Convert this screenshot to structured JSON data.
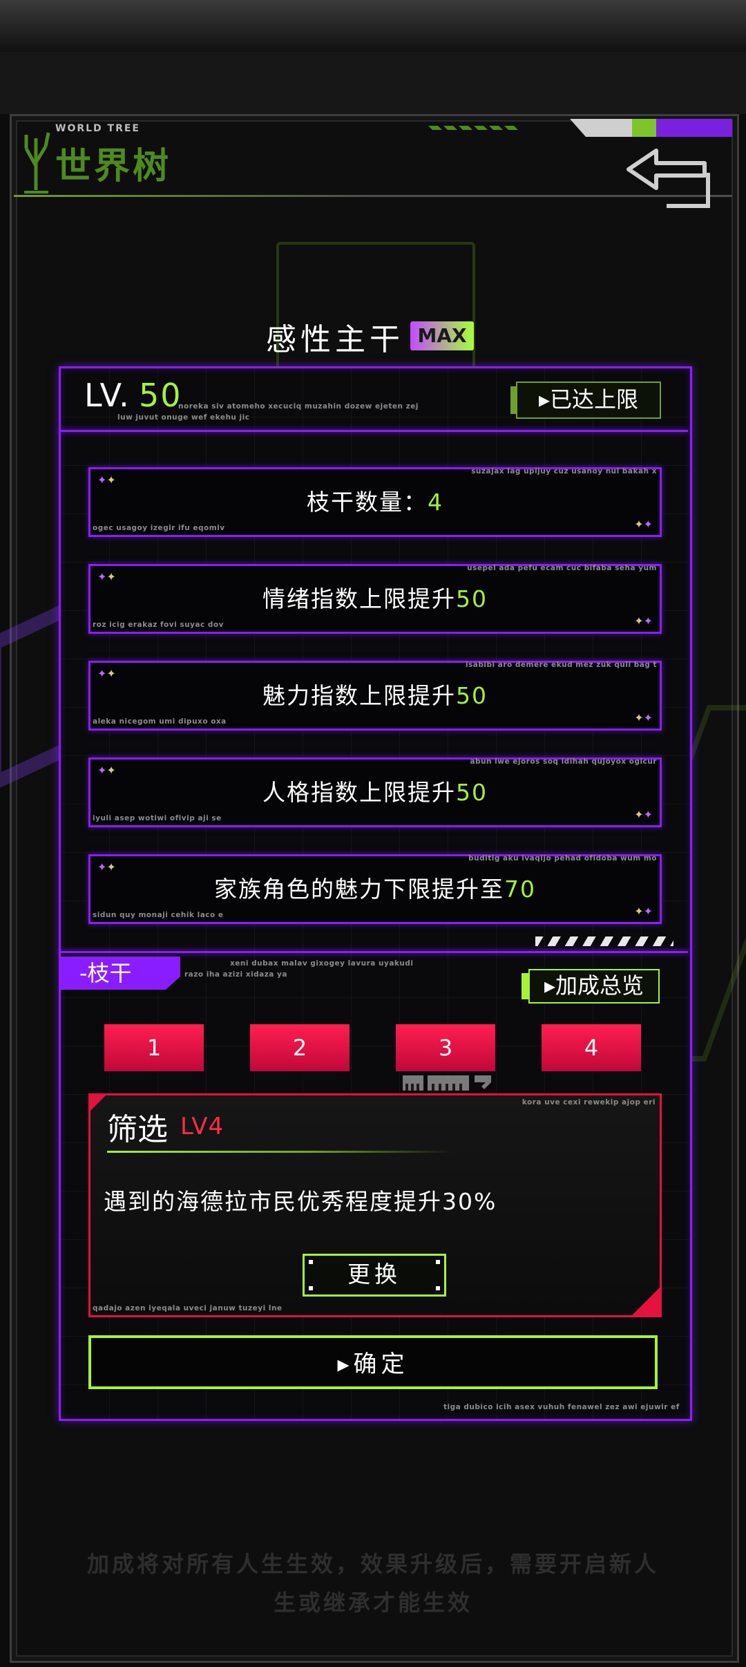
{
  "header": {
    "small_title": "WORLD TREE",
    "title": "世界树",
    "back_icon": "back-arrow-icon"
  },
  "branch": {
    "title": "感性主干",
    "max_badge": "MAX",
    "level_prefix": "LV.",
    "level_value": "50",
    "level_status": "已达上限",
    "level_caption_1": "noreka siv atomeho xecuciq muzahin dozew ejeten zej",
    "level_caption_2": "luw juvut onuge wef ekehu jic"
  },
  "effects": [
    {
      "text": "枝干数量：",
      "value": "4",
      "caption_tr": "suzajax lag upijuy cuz usanoy nul bakah x",
      "caption_bl": "ogec usagoy izegir ifu eqomiv"
    },
    {
      "text": "情绪指数上限提升",
      "value": "50",
      "caption_tr": "usepel ada pefu ecam cuc bifaba seha yum",
      "caption_bl": "roz icig erakaz fovi suyac dov"
    },
    {
      "text": "魅力指数上限提升",
      "value": "50",
      "caption_tr": "isabibi aro demere ekud mez zuk quli bag t",
      "caption_bl": "aleka nicegom umi dipuxo oxa"
    },
    {
      "text": "人格指数上限提升",
      "value": "50",
      "caption_tr": "abun iwe ejoros soq idihah qujoyox ogicur",
      "caption_bl": "iyuli asep wotiwi ofivip aji se"
    },
    {
      "text": "家族角色的魅力下限提升至",
      "value": "70",
      "caption_tr": "buditig aku ivaqijo pehad ofidoba wum mo",
      "caption_bl": "sidun quy monaji cehik laco e"
    }
  ],
  "sub_branch": {
    "tag": "-枝干",
    "caption_1": "xeni dubax malav gixogey lavura uyakudi",
    "caption_2": "razo iha azizi xidaza ya",
    "bonus_button": "加成总览",
    "tabs": [
      "1",
      "2",
      "3",
      "4"
    ]
  },
  "skill": {
    "name": "筛选",
    "level": "LV4",
    "description": "遇到的海德拉市民优秀程度提升30%",
    "change_button": "更换",
    "caption_tr": "kora uve cexi rewekip ajop eri",
    "caption_bl": "qadajo azen iyeqala uveci januw tuzeyi lne"
  },
  "confirm_button": "确定",
  "panel_footer_caption": "tiga dubico icih asex vuhuh fenawel zez awi ejuwir ef",
  "footer_note_1": "加成将对所有人生生效，效果升级后，需要开启新人",
  "footer_note_2": "生或继承才能生效",
  "colors": {
    "accent_purple": "#8a1dff",
    "accent_green": "#a6f23a",
    "accent_red": "#e3123f"
  }
}
